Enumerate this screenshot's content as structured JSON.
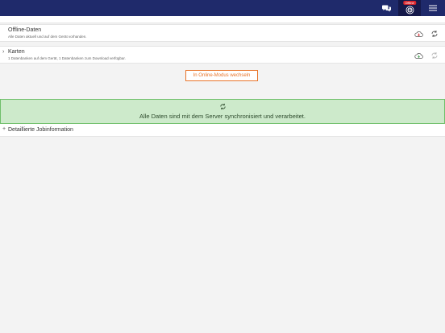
{
  "header": {
    "status_badge": "Offline",
    "icons": {
      "chat": "chat-bubbles-icon",
      "status": "offline-status-icon",
      "menu": "hamburger-menu-icon"
    }
  },
  "offline_data": {
    "title": "Offline-Daten",
    "subtitle": "Alle Daten aktuell und auf dem Gerät vorhanden.",
    "icons": {
      "cloud": "cloud-download-icon",
      "sync": "sync-icon"
    }
  },
  "maps": {
    "title": "Karten",
    "subtitle": "1 Datenbanken auf dem Gerät, 1 Datenbanken zum Download verfügbar.",
    "icons": {
      "cloud": "cloud-download-icon",
      "sync": "sync-icon"
    }
  },
  "mode_button": {
    "label": "In Online-Modus wechseln"
  },
  "sync_status": {
    "message": "Alle Daten sind mit dem Server synchronisiert und verarbeitet."
  },
  "job_info": {
    "label": "Detaillierte Jobinformation"
  },
  "colors": {
    "header_bg": "#1f2a6b",
    "accent_orange": "#e8742a",
    "success_bg": "#cdeacb",
    "success_border": "#6fbf6a",
    "offline_red": "#d9262d",
    "cloud_green": "#3a9a4a"
  }
}
